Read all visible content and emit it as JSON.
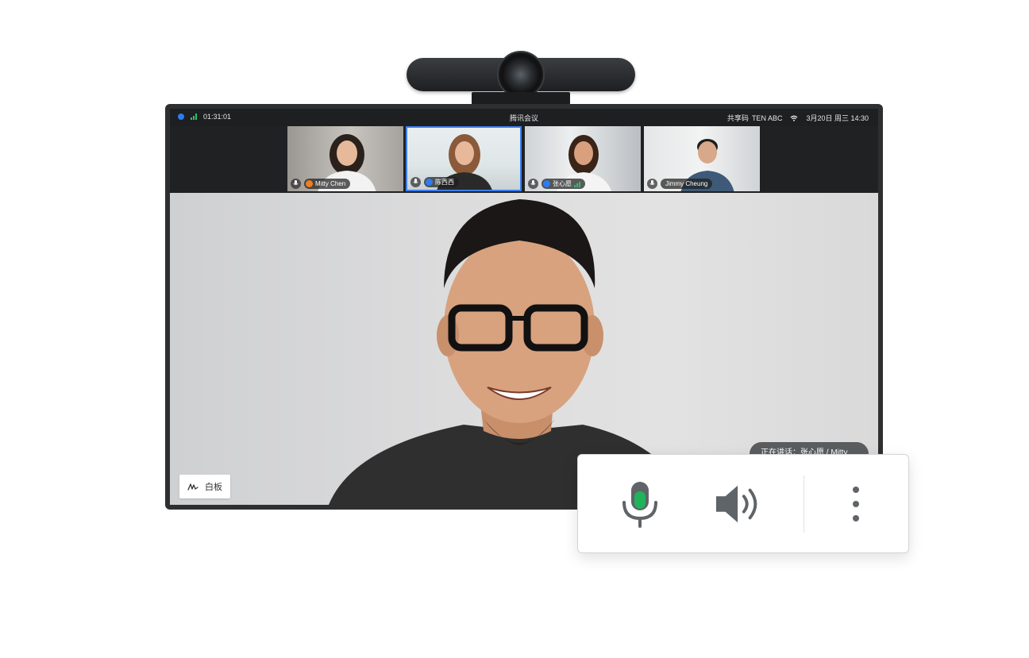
{
  "status_bar": {
    "time": "01:31:01",
    "title": "腾讯会议",
    "share_code_label": "共享码",
    "share_code": "TEN ABC",
    "datetime": "3月20日 周三 14:30"
  },
  "participants": [
    {
      "name": "Mitty Chen",
      "role_color": "#f07c24",
      "active": false
    },
    {
      "name": "陈西西",
      "role_color": "#2f7bf0",
      "active": true
    },
    {
      "name": "张心愿",
      "role_color": "#2f7bf0",
      "active": false
    },
    {
      "name": "Jimmy Cheung",
      "role_color": "",
      "active": false
    }
  ],
  "main_view": {
    "whiteboard_label": "白板",
    "speaking_text": "正在讲话：张心愿 / Mitty"
  },
  "controls": {
    "mic_icon": "microphone-icon",
    "speaker_icon": "speaker-icon",
    "more_icon": "more-vertical-icon",
    "mic_active_color": "#21b35b"
  }
}
